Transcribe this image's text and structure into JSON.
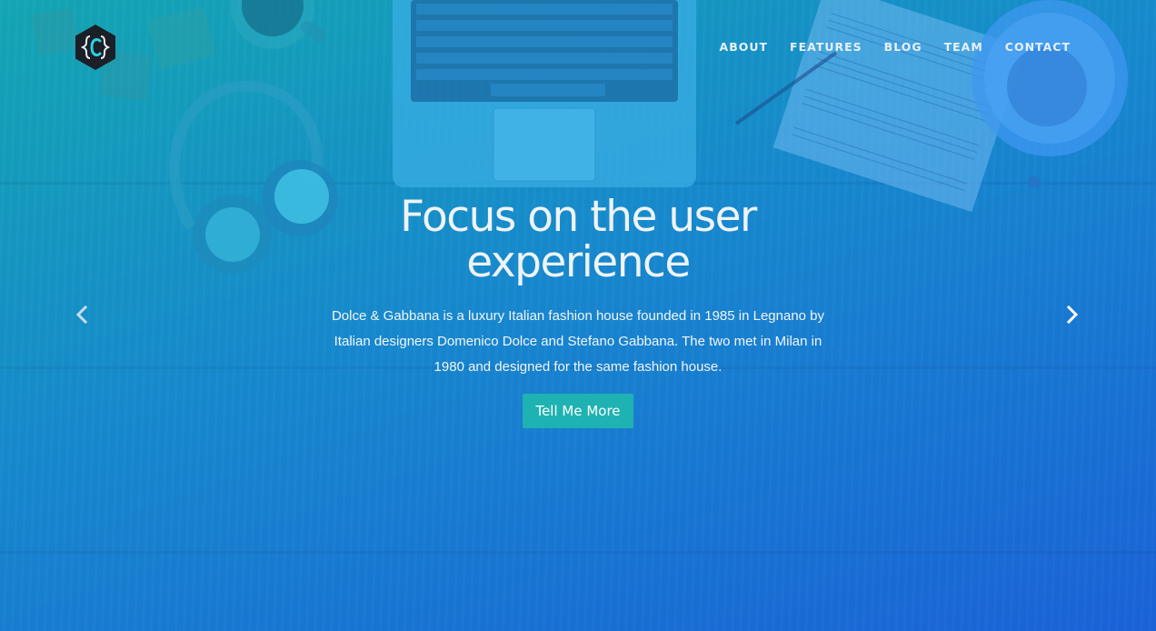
{
  "nav": {
    "items": [
      {
        "label": "ABOUT"
      },
      {
        "label": "FEATURES"
      },
      {
        "label": "BLOG"
      },
      {
        "label": "TEAM"
      },
      {
        "label": "CONTACT"
      }
    ]
  },
  "logo": {
    "icon": "hexagon-code-bracket-logo"
  },
  "hero": {
    "title": "Focus on the user experience",
    "description": "Dolce & Gabbana is a luxury Italian fashion house founded in 1985 in Legnano by Italian designers Domenico Dolce and Stefano Gabbana. The two met in Milan in 1980 and designed for the same fashion house.",
    "cta_label": "Tell Me More"
  },
  "carousel": {
    "prev_icon": "chevron-left-icon",
    "next_icon": "chevron-right-icon"
  },
  "colors": {
    "gradient_start": "#14a7b4",
    "gradient_end": "#1a63d9",
    "cta_background": "#1fb2b2",
    "logo_accent": "#29d3e6"
  }
}
